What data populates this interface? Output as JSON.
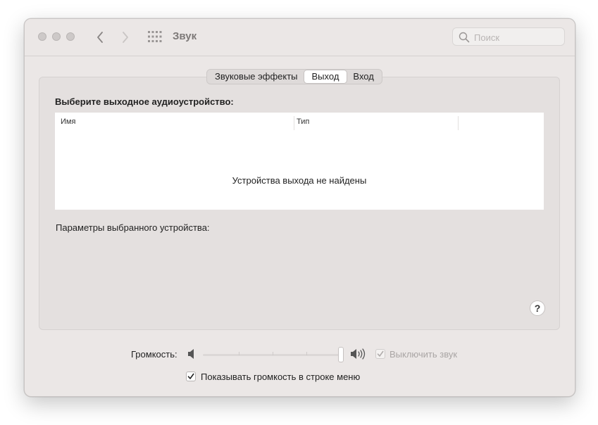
{
  "window": {
    "title": "Звук"
  },
  "search": {
    "placeholder": "Поиск",
    "value": ""
  },
  "tabs": [
    {
      "label": "Звуковые эффекты",
      "active": false
    },
    {
      "label": "Выход",
      "active": true
    },
    {
      "label": "Вход",
      "active": false
    }
  ],
  "output": {
    "heading": "Выберите выходное аудиоустройство:",
    "columns": [
      "Имя",
      "Тип"
    ],
    "empty_message": "Устройства выхода не найдены",
    "settings_label": "Параметры выбранного устройства:"
  },
  "help": {
    "label": "?"
  },
  "volume": {
    "label": "Громкость:",
    "level": 1.0,
    "mute_label": "Выключить звук",
    "mute_checked": true,
    "mute_enabled": false,
    "show_in_menu_label": "Показывать громкость в строке меню",
    "show_in_menu_checked": true
  },
  "icons": {
    "back": "chevron-left-icon",
    "forward": "chevron-right-icon",
    "show_all": "grid-icon",
    "search": "search-icon",
    "volume_low": "speaker-low-icon",
    "volume_high": "speaker-high-icon"
  },
  "colors": {
    "window_bg": "#ebe7e6",
    "panel_bg": "#e4e0df",
    "table_bg": "#ffffff"
  }
}
